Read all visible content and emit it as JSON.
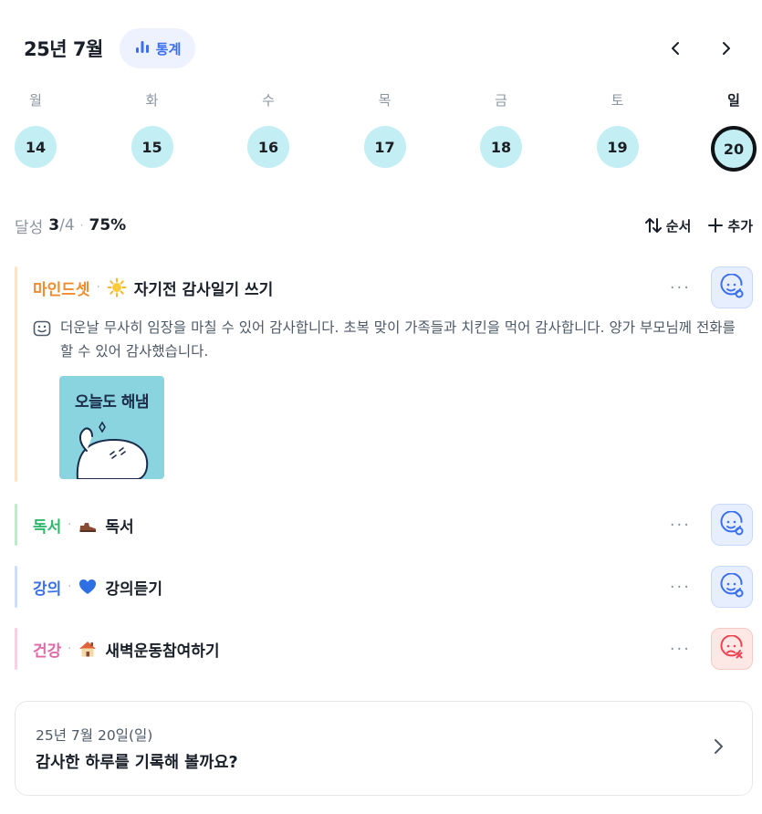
{
  "header": {
    "month_title": "25년 7월",
    "stats_label": "통계",
    "stats_icon": "bar-chart-icon",
    "prev_icon": "chevron-left-icon",
    "next_icon": "chevron-right-icon"
  },
  "week": [
    {
      "label": "월",
      "date": "14"
    },
    {
      "label": "화",
      "date": "15"
    },
    {
      "label": "수",
      "date": "16"
    },
    {
      "label": "목",
      "date": "17"
    },
    {
      "label": "금",
      "date": "18"
    },
    {
      "label": "토",
      "date": "19"
    },
    {
      "label": "일",
      "date": "20",
      "selected": true
    }
  ],
  "summary": {
    "label": "달성",
    "count": "3",
    "total": "/4",
    "percent": "75%",
    "sort_label": "순서",
    "add_label": "추가"
  },
  "habits": [
    {
      "category": "마인드셋",
      "emoji": "sun-icon",
      "name": "자기전 감사일기 쓰기",
      "status": "done",
      "memo": "더운날 무사히 임장을 마칠 수 있어 감사합니다. 초복 맞이 가족들과 치킨을 먹어 감사합니다. 양가 부모님께 전화를 할 수 있어 감사했습니다.",
      "image_text": "오늘도 해냄",
      "colors": {
        "bar": "#fde3c6",
        "category": "#f08c2e"
      }
    },
    {
      "category": "독서",
      "emoji": "shoe-icon",
      "name": "독서",
      "status": "done",
      "colors": {
        "bar": "#bfeacb",
        "category": "#2fb86b"
      }
    },
    {
      "category": "강의",
      "emoji": "heart-icon",
      "name": "강의듣기",
      "status": "done",
      "colors": {
        "bar": "#cfdcfb",
        "category": "#3a6ff0"
      }
    },
    {
      "category": "건강",
      "emoji": "house-icon",
      "name": "새벽운동참여하기",
      "status": "fail",
      "colors": {
        "bar": "#f8cfe3",
        "category": "#e06aa8"
      }
    }
  ],
  "record": {
    "date": "25년 7월 20일(일)",
    "prompt": "감사한 하루를 기록해 볼까요?"
  },
  "colors": {
    "accent": "#3a6ff0",
    "day_circle": "#c3eef3",
    "fail": "#f04452"
  }
}
